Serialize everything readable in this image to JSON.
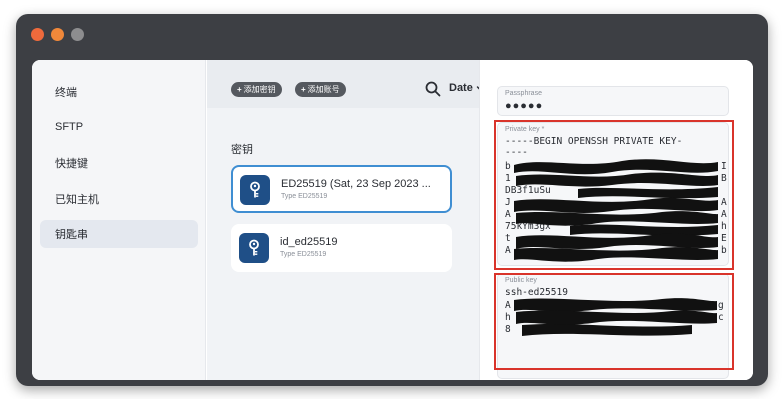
{
  "window": {
    "controls": [
      "close",
      "minimize",
      "zoom"
    ]
  },
  "sidebar": {
    "items": [
      {
        "label": "终端",
        "active": false
      },
      {
        "label": "SFTP",
        "active": false
      },
      {
        "label": "快捷键",
        "active": false
      },
      {
        "label": "已知主机",
        "active": false
      },
      {
        "label": "钥匙串",
        "active": true
      }
    ]
  },
  "toolbar": {
    "add_key_label": "添加密钥",
    "add_account_label": "添加账号",
    "sort_label": "Date",
    "icons": [
      "search-icon",
      "chevron-down-icon"
    ]
  },
  "keys_section": {
    "title": "密钥",
    "items": [
      {
        "name": "ED25519 (Sat, 23 Sep 2023 ...",
        "type": "Type ED25519",
        "selected": true,
        "icon": "key-icon"
      },
      {
        "name": "id_ed25519",
        "type": "Type ED25519",
        "selected": false,
        "icon": "key-icon"
      }
    ]
  },
  "detail": {
    "passphrase": {
      "label": "Passphrase",
      "value": "●●●●●"
    },
    "private_key": {
      "label": "Private key *",
      "visible_lines": [
        "-----BEGIN OPENSSH PRIVATE KEY-",
        "----",
        "b",
        "1",
        "DB3f1uSu",
        "J",
        "A",
        "75kYm3gx",
        "t",
        "A"
      ],
      "trailing_chars": [
        "I",
        "B",
        "A",
        "A",
        "h",
        "E",
        "b"
      ]
    },
    "public_key": {
      "label": "Public key",
      "visible_lines": [
        "ssh-ed25519",
        "A",
        "h",
        "8"
      ],
      "trailing_chars": [
        "g",
        "c"
      ]
    }
  },
  "colors": {
    "frame": "#3d3f44",
    "accent": "#3f8ed2",
    "key_icon_bg": "#1f4f87",
    "highlight": "#d9342b",
    "redaction": "#111111"
  }
}
